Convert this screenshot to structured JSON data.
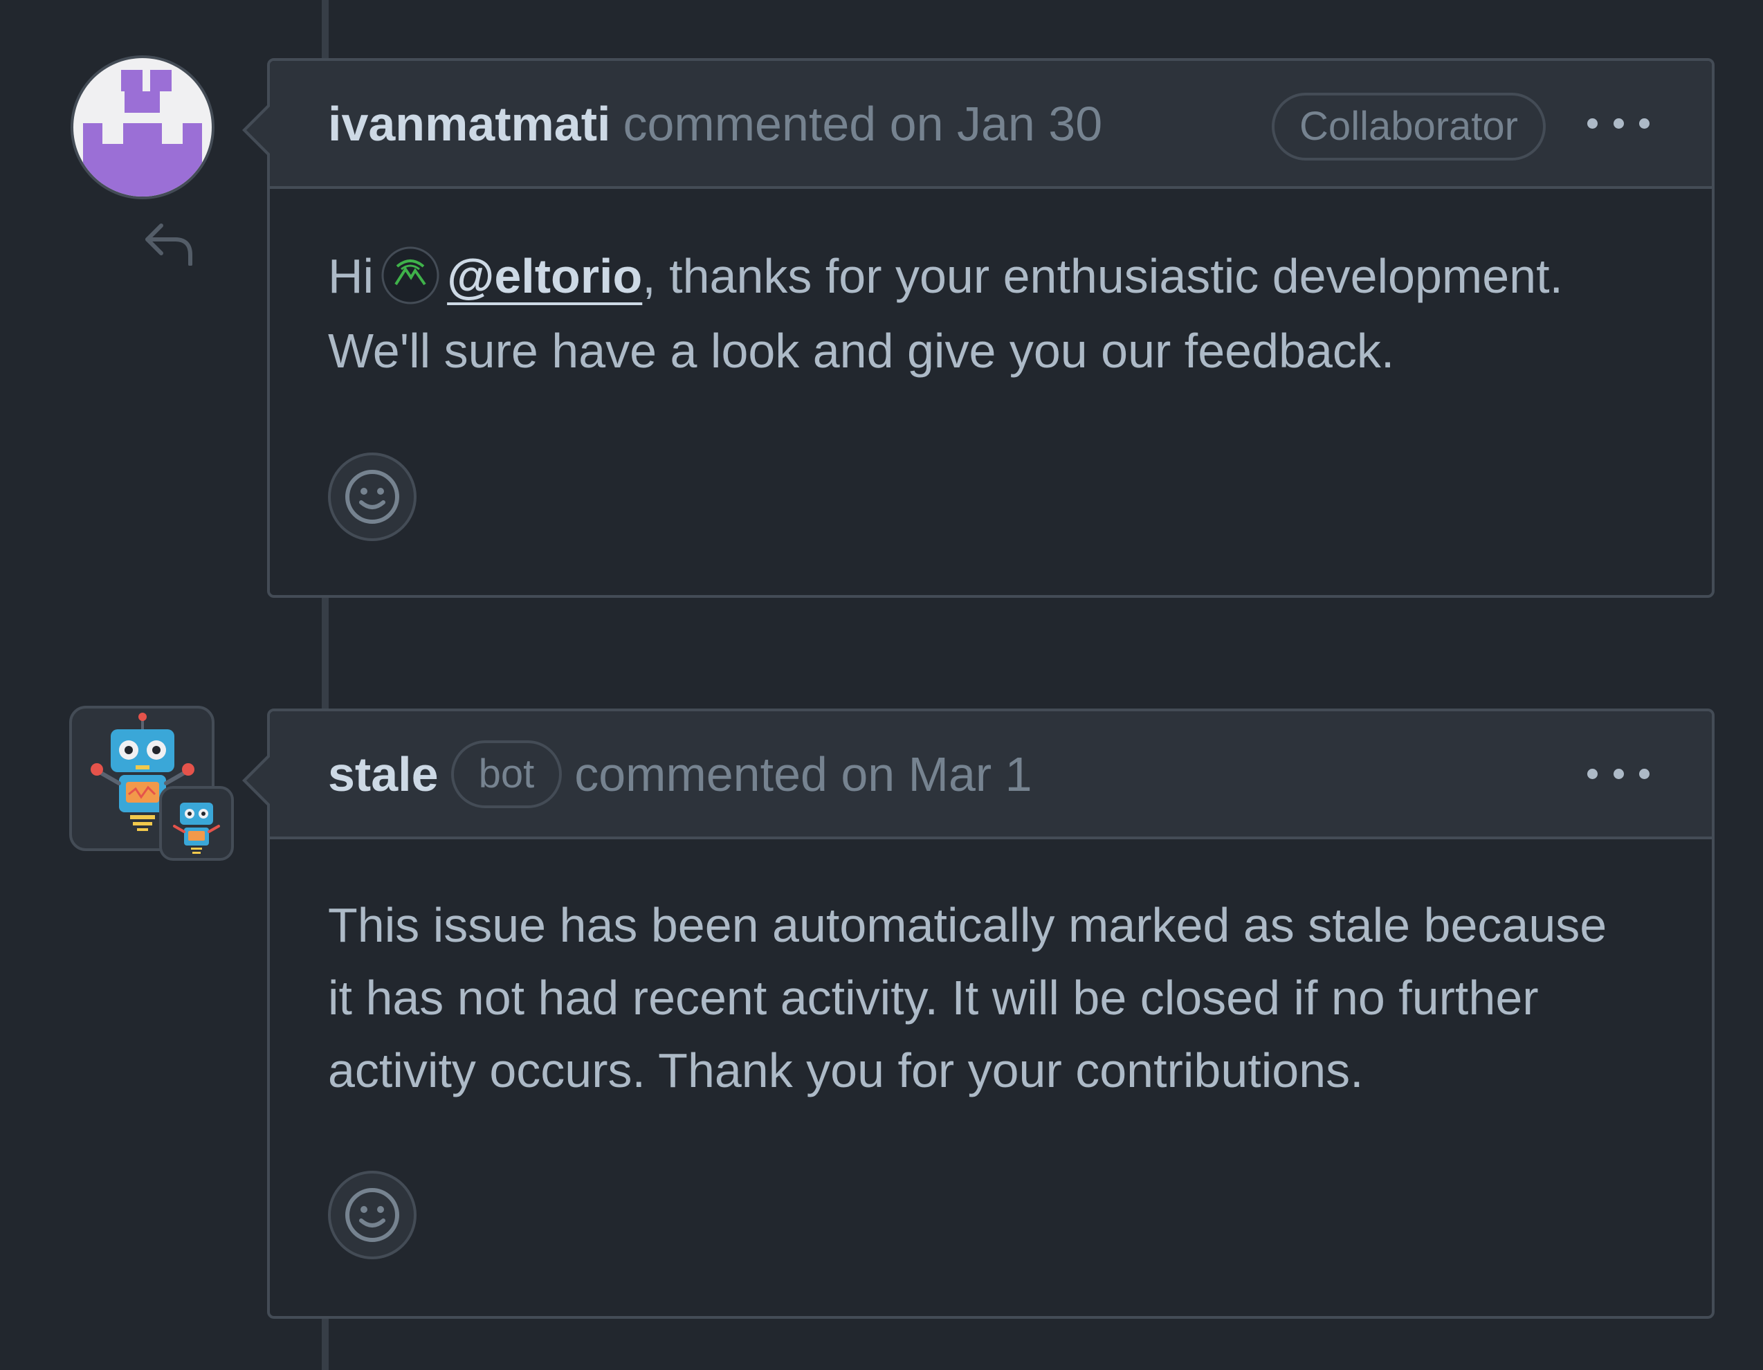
{
  "comments": [
    {
      "author": "ivanmatmati",
      "action": "commented on Jan 30",
      "badge": "Collaborator",
      "body": {
        "greeting": "Hi",
        "mention": "@eltorio",
        "line1_rest": ", thanks for your enthusiastic development.",
        "line2": "We'll sure have a look and give you our feedback."
      },
      "avatar_color": "#9b6fd6"
    },
    {
      "author": "stale",
      "author_badge": "bot",
      "action": "commented on Mar 1",
      "body": {
        "line1": "This issue has been automatically marked as stale because",
        "line2": "it has not had recent activity. It will be closed if no further",
        "line3": "activity occurs. Thank you for your contributions."
      }
    }
  ],
  "icons": {
    "more": "kebab-horizontal-icon",
    "reaction": "smiley-icon",
    "reply": "reply-icon"
  },
  "colors": {
    "background": "#22272e",
    "header": "#2d333b",
    "border": "#444c56",
    "text": "#adbac7",
    "muted": "#768390"
  }
}
